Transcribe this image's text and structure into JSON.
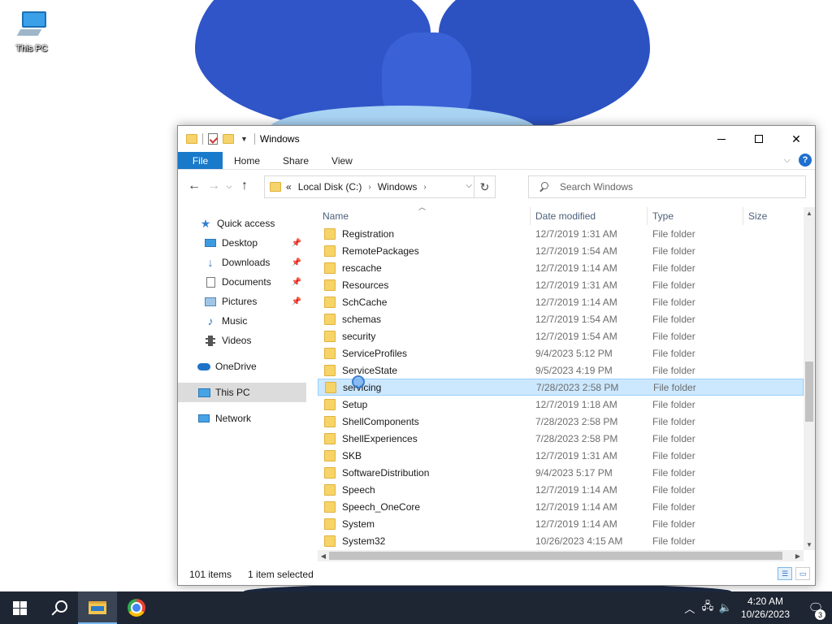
{
  "desktop": {
    "icon_label": "This PC"
  },
  "window": {
    "title": "Windows",
    "ribbon_tabs": [
      "File",
      "Home",
      "Share",
      "View"
    ],
    "address": {
      "overflow": "«",
      "crumbs": [
        "Local Disk (C:)",
        "Windows"
      ]
    },
    "search": {
      "placeholder": "Search Windows"
    },
    "nav_pane": {
      "quick_access": "Quick access",
      "desktop": "Desktop",
      "downloads": "Downloads",
      "documents": "Documents",
      "pictures": "Pictures",
      "music": "Music",
      "videos": "Videos",
      "onedrive": "OneDrive",
      "this_pc": "This PC",
      "network": "Network"
    },
    "columns": {
      "name": "Name",
      "date": "Date modified",
      "type": "Type",
      "size": "Size"
    },
    "files": [
      {
        "name": "Registration",
        "date": "12/7/2019 1:31 AM",
        "type": "File folder"
      },
      {
        "name": "RemotePackages",
        "date": "12/7/2019 1:54 AM",
        "type": "File folder"
      },
      {
        "name": "rescache",
        "date": "12/7/2019 1:14 AM",
        "type": "File folder"
      },
      {
        "name": "Resources",
        "date": "12/7/2019 1:31 AM",
        "type": "File folder"
      },
      {
        "name": "SchCache",
        "date": "12/7/2019 1:14 AM",
        "type": "File folder"
      },
      {
        "name": "schemas",
        "date": "12/7/2019 1:54 AM",
        "type": "File folder"
      },
      {
        "name": "security",
        "date": "12/7/2019 1:54 AM",
        "type": "File folder"
      },
      {
        "name": "ServiceProfiles",
        "date": "9/4/2023 5:12 PM",
        "type": "File folder"
      },
      {
        "name": "ServiceState",
        "date": "9/5/2023 4:19 PM",
        "type": "File folder"
      },
      {
        "name": "servicing",
        "date": "7/28/2023 2:58 PM",
        "type": "File folder",
        "selected": true
      },
      {
        "name": "Setup",
        "date": "12/7/2019 1:18 AM",
        "type": "File folder"
      },
      {
        "name": "ShellComponents",
        "date": "7/28/2023 2:58 PM",
        "type": "File folder"
      },
      {
        "name": "ShellExperiences",
        "date": "7/28/2023 2:58 PM",
        "type": "File folder"
      },
      {
        "name": "SKB",
        "date": "12/7/2019 1:31 AM",
        "type": "File folder"
      },
      {
        "name": "SoftwareDistribution",
        "date": "9/4/2023 5:17 PM",
        "type": "File folder"
      },
      {
        "name": "Speech",
        "date": "12/7/2019 1:14 AM",
        "type": "File folder"
      },
      {
        "name": "Speech_OneCore",
        "date": "12/7/2019 1:14 AM",
        "type": "File folder"
      },
      {
        "name": "System",
        "date": "12/7/2019 1:14 AM",
        "type": "File folder"
      },
      {
        "name": "System32",
        "date": "10/26/2023 4:15 AM",
        "type": "File folder"
      }
    ],
    "status": {
      "count": "101 items",
      "selection": "1 item selected"
    }
  },
  "taskbar": {
    "time": "4:20 AM",
    "date": "10/26/2023",
    "notification_count": "3"
  },
  "colors": {
    "accent": "#1979ca",
    "selection": "#cce8ff",
    "taskbar": "#1f2633"
  }
}
